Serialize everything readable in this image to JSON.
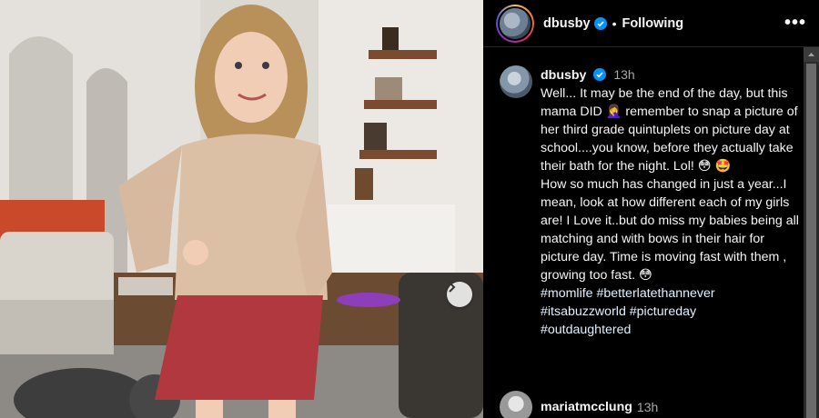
{
  "post": {
    "username": "dbusby",
    "follow_state": "Following",
    "separator": "•",
    "more_icon": "more-options-icon"
  },
  "caption": {
    "username": "dbusby",
    "time": "13h",
    "lines": [
      "Well... It may be the end of the day, but this mama DID 🤦‍♀️ remember to snap a picture of her third grade quintuplets on picture day at school....you know, before they actually take their bath for the night. Lol! 😳 🤩",
      "How so much has changed in just a year...I mean, look at how different each of my girls are! I Love it..but do miss my babies being all matching and with bows in their hair for picture day. Time is moving fast with them , growing too fast. 😳"
    ],
    "hashtags_line1": "#momlife #betterlatethannever",
    "hashtags_line2": "#itsabuzzworld #pictureday",
    "hashtags_line3": "#outdaughtered"
  },
  "comment": {
    "username": "mariatmcclung",
    "time": "13h"
  },
  "colors": {
    "background": "#000000",
    "verified": "#0095f6",
    "muted_text": "#a8a8a8",
    "hashtag": "#e0f1ff"
  }
}
